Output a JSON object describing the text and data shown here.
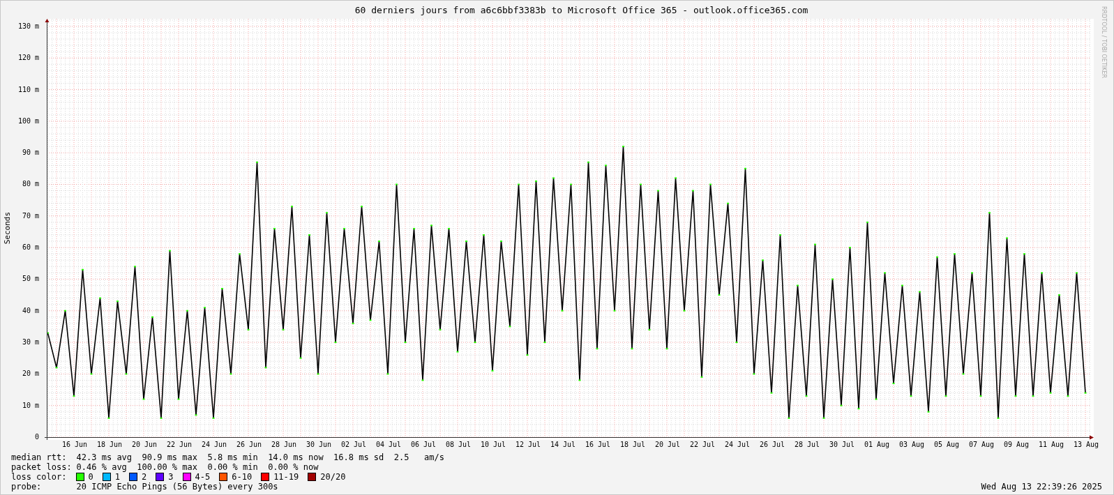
{
  "credit": "RRDTOOL / TOBI OETIKER",
  "graph": {
    "chart_data": {
      "type": "line",
      "title": "60 derniers jours from a6c6bbf3383b to Microsoft Office 365 - outlook.office365.com",
      "ylabel": "Seconds",
      "categories": [
        null,
        null,
        null,
        "16 Jun",
        null,
        null,
        null,
        "18 Jun",
        null,
        null,
        null,
        "20 Jun",
        null,
        null,
        null,
        "22 Jun",
        null,
        null,
        null,
        "24 Jun",
        null,
        null,
        null,
        "26 Jun",
        null,
        null,
        null,
        "28 Jun",
        null,
        null,
        null,
        "30 Jun",
        null,
        null,
        null,
        "02 Jul",
        null,
        null,
        null,
        "04 Jul",
        null,
        null,
        null,
        "06 Jul",
        null,
        null,
        null,
        "08 Jul",
        null,
        null,
        null,
        "10 Jul",
        null,
        null,
        null,
        "12 Jul",
        null,
        null,
        null,
        "14 Jul",
        null,
        null,
        null,
        "16 Jul",
        null,
        null,
        null,
        "18 Jul",
        null,
        null,
        null,
        "20 Jul",
        null,
        null,
        null,
        "22 Jul",
        null,
        null,
        null,
        "24 Jul",
        null,
        null,
        null,
        "26 Jul",
        null,
        null,
        null,
        "28 Jul",
        null,
        null,
        null,
        "30 Jul",
        null,
        null,
        null,
        "01 Aug",
        null,
        null,
        null,
        "03 Aug",
        null,
        null,
        null,
        "05 Aug",
        null,
        null,
        null,
        "07 Aug",
        null,
        null,
        null,
        "09 Aug",
        null,
        null,
        null,
        "11 Aug",
        null,
        null,
        null,
        "13 Aug"
      ],
      "series": [
        {
          "name": "median rtt:",
          "color": "#000000",
          "marker": "square",
          "values": [
            33,
            22,
            40,
            13,
            53,
            20,
            44,
            6,
            43,
            20,
            54,
            12,
            38,
            6,
            59,
            12,
            40,
            7,
            41,
            6,
            47,
            20,
            58,
            34,
            87,
            22,
            66,
            34,
            73,
            25,
            64,
            20,
            71,
            30,
            66,
            36,
            73,
            37,
            62,
            20,
            80,
            30,
            66,
            18,
            67,
            34,
            66,
            27,
            62,
            30,
            64,
            21,
            62,
            35,
            80,
            26,
            81,
            30,
            82,
            40,
            80,
            18,
            87,
            28,
            86,
            40,
            92,
            28,
            80,
            34,
            78,
            28,
            82,
            40,
            78,
            19,
            80,
            45,
            74,
            30,
            85,
            20,
            56,
            14,
            64,
            6,
            48,
            13,
            61,
            6,
            50,
            10,
            60,
            9,
            68,
            12,
            52,
            17,
            48,
            13,
            46,
            8,
            57,
            13,
            58,
            20,
            52,
            13,
            71,
            6,
            63,
            13,
            58,
            13,
            52,
            14,
            45,
            13,
            52,
            14
          ]
        }
      ],
      "grid": true,
      "ylim": [
        0,
        132.4
      ],
      "yticks": [
        {
          "value": 130,
          "label": "130 m"
        },
        {
          "value": 120,
          "label": "120 m"
        },
        {
          "value": 110,
          "label": "110 m"
        },
        {
          "value": 100,
          "label": "100 m"
        },
        {
          "value": 90,
          "label": "90 m"
        },
        {
          "value": 80,
          "label": "80 m"
        },
        {
          "value": 70,
          "label": "70 m"
        },
        {
          "value": 60,
          "label": "60 m"
        },
        {
          "value": 50,
          "label": "50 m"
        },
        {
          "value": 40,
          "label": "40 m"
        },
        {
          "value": 30,
          "label": "30 m"
        },
        {
          "value": 20,
          "label": "20 m"
        },
        {
          "value": 10,
          "label": "10 m"
        },
        {
          "value": 0,
          "label": "0"
        }
      ]
    }
  },
  "legend": [
    {
      "kind": "series",
      "text": "42.3 ms avg  90.9 ms max  5.8 ms min  14.0 ms now  16.8 ms sd  2.5   am/s"
    },
    {
      "kind": "stats",
      "label": "packet loss:",
      "text": "0.46 % avg  100.00 % max  0.00 % min  0.00 % now"
    },
    {
      "kind": "colors",
      "label": "loss color:",
      "items": [
        {
          "label": "0",
          "color": "#26ff00"
        },
        {
          "label": "1",
          "color": "#00b8ff"
        },
        {
          "label": "2",
          "color": "#0059ff"
        },
        {
          "label": "3",
          "color": "#5e00ff"
        },
        {
          "label": "4-5",
          "color": "#ff00ff"
        },
        {
          "label": "6-10",
          "color": "#ff5500"
        },
        {
          "label": "11-19",
          "color": "#ff0000"
        },
        {
          "label": "20/20",
          "color": "#a10000"
        }
      ]
    },
    {
      "kind": "stats",
      "label": "probe:",
      "text": "20 ICMP Echo Pings (56 Bytes) every 300s"
    }
  ],
  "timestamp": "Wed Aug 13 22:39:26 2025"
}
